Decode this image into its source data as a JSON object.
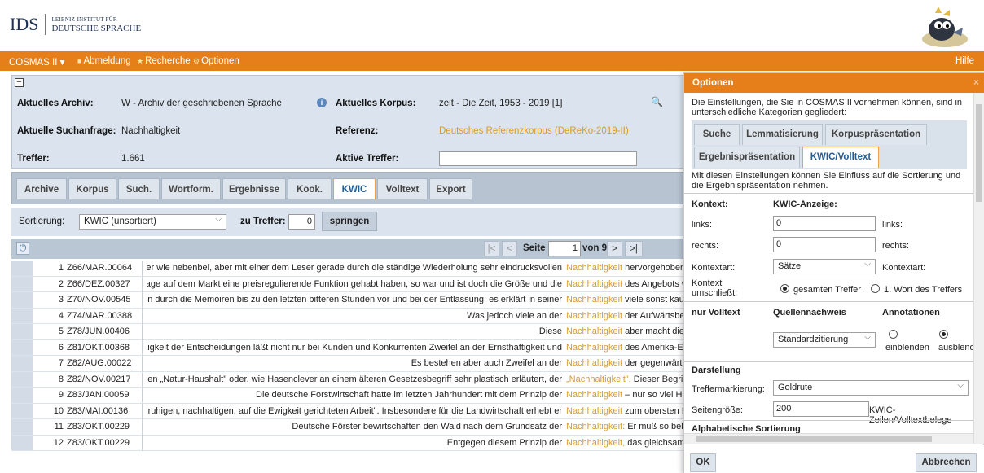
{
  "header": {
    "logo_main": "IDS",
    "logo_line1": "LEIBNIZ-INSTITUT FÜR",
    "logo_line2": "DEUTSCHE SPRACHE"
  },
  "menubar": {
    "app": "COSMAS II ▾",
    "abmeldung": "Abmeldung",
    "recherche": "Recherche",
    "optionen": "Optionen",
    "hilfe": "Hilfe"
  },
  "info": {
    "archiv_label": "Aktuelles Archiv:",
    "archiv_value": "W - Archiv der geschriebenen Sprache",
    "korpus_label": "Aktuelles Korpus:",
    "korpus_value": "zeit - Die Zeit, 1953 - 2019 [1]",
    "suchanfrage_label": "Aktuelle Suchanfrage:",
    "suchanfrage_value": "Nachhaltigkeit",
    "referenz_label": "Referenz:",
    "referenz_value": "Deutsches Referenzkorpus (DeReKo-2019-II)",
    "treffer_label": "Treffer:",
    "treffer_value": "1.661",
    "aktive_label": "Aktive Treffer:",
    "aktive_value": ""
  },
  "tabs": [
    "Archive",
    "Korpus",
    "Such.",
    "Wortform.",
    "Ergebnisse",
    "Kook.",
    "KWIC",
    "Volltext",
    "Export"
  ],
  "active_tab": "KWIC",
  "sortbar": {
    "label": "Sortierung:",
    "selected": "KWIC (unsortiert)",
    "zu_label": "zu Treffer:",
    "zu_value": "0",
    "button": "springen"
  },
  "pager": {
    "first": "|<",
    "prev": "<",
    "label": "Seite",
    "page": "1",
    "of": "von 9",
    "next": ">",
    "last": ">|"
  },
  "rows": [
    {
      "no": "1",
      "sig": "Z66/MAR.00064",
      "left": "...er wie nebenbei, aber mit einer dem Leser gerade durch die ständige Wiederholung sehr eindrucksvollen",
      "kw": "Nachhaltigkeit",
      "right": " hervorgehoben,"
    },
    {
      "no": "2",
      "sig": "Z66/DEZ.00327",
      "left": "...age auf dem Markt eine preisregulierende Funktion gehabt haben, so war und ist doch die Größe und die",
      "kw": "Nachhaltigkeit",
      "right": " des Angebots w"
    },
    {
      "no": "3",
      "sig": "Z70/NOV.00545",
      "left": "...n durch die Memoiren bis zu den letzten bitteren Stunden vor und bei der Entlassung; es erklärt in seiner",
      "kw": "Nachhaltigkeit",
      "right": " viele sonst kaum"
    },
    {
      "no": "4",
      "sig": "Z74/MAR.00388",
      "left": "Was jedoch viele an der",
      "kw": "Nachhaltigkeit",
      "right": " der Aufwärtsbe"
    },
    {
      "no": "5",
      "sig": "Z78/JUN.00406",
      "left": "Diese",
      "kw": "Nachhaltigkeit",
      "right": " aber macht die"
    },
    {
      "no": "6",
      "sig": "Z81/OKT.00368",
      "left": "...tigkeit der Entscheidungen läßt nicht nur bei Kunden und Konkurrenten Zweifel an der Ernsthaftigkeit und",
      "kw": "Nachhaltigkeit",
      "right": " des Amerika-En"
    },
    {
      "no": "7",
      "sig": "Z82/AUG.00022",
      "left": "Es bestehen aber auch Zweifel an der",
      "kw": "Nachhaltigkeit",
      "right": " der gegenwärtig"
    },
    {
      "no": "8",
      "sig": "Z82/NOV.00217",
      "left": "...en „Natur-Haushalt\" oder, wie Hasenclever an einem älteren Gesetzesbegriff sehr plastisch erläutert, der",
      "kw": "„Nachhaltigkeit\".",
      "right": " Dieser Begriff"
    },
    {
      "no": "9",
      "sig": "Z83/JAN.00059",
      "left": "Die deutsche Forstwirtschaft hatte im letzten Jahrhundert mit dem Prinzip der",
      "kw": "Nachhaltigkeit",
      "right": " – nur so viel Ho"
    },
    {
      "no": "10",
      "sig": "Z83/MAI.00136",
      "left": "...r ruhigen, nachhaltigen, auf die Ewigkeit gerichteten Arbeit\". Insbesondere für die Landwirtschaft erhebt er",
      "kw": "Nachhaltigkeit",
      "right": " zum obersten P"
    },
    {
      "no": "11",
      "sig": "Z83/OKT.00229",
      "left": "Deutsche Förster bewirtschaften den Wald nach dem Grundsatz der",
      "kw": "Nachhaltigkeit:",
      "right": " Er muß so beh"
    },
    {
      "no": "12",
      "sig": "Z83/OKT.00229",
      "left": "Entgegen diesem Prinzip der",
      "kw": "Nachhaltigkeit,",
      "right": " das gleichsam"
    }
  ],
  "dialog": {
    "title": "Optionen",
    "close": "×",
    "intro": "Die Einstellungen, die Sie in COSMAS II vornehmen können, sind in unterschiedliche Kategorien gegliedert:",
    "tabs_row1": [
      "Suche",
      "Lemmatisierung",
      "Korpuspräsentation"
    ],
    "tabs_row2": [
      "Ergebnispräsentation",
      "KWIC/Volltext"
    ],
    "active_tab": "KWIC/Volltext",
    "desc": "Mit diesen Einstellungen können Sie Einfluss auf die Sortierung und die Ergebnispräsentation nehmen.",
    "kontext": "Kontext:",
    "kwic_anzeige": "KWIC-Anzeige:",
    "links": "links:",
    "links_value": "0",
    "links2": "links:",
    "rechts": "rechts:",
    "rechts_value": "0",
    "rechts2": "rechts:",
    "kontextart": "Kontextart:",
    "kontextart_value": "Sätze",
    "kontextart2": "Kontextart:",
    "umschliesst": "Kontext umschließt:",
    "opt_gesamt": "gesamten Treffer",
    "opt_erstes": "1. Wort des Treffers",
    "nur_volltext": "nur Volltext",
    "quellennachweis": "Quellennachweis",
    "annotationen": "Annotationen",
    "quellen_value": "Standardzitierung",
    "einblenden": "einblenden",
    "ausblenden": "ausblend",
    "darstellung": "Darstellung",
    "treffermarkierung": "Treffermarkierung:",
    "treffermarkierung_value": "Goldrute",
    "seitengroesse": "Seitengröße:",
    "seitengroesse_value": "200",
    "seitengroesse_unit": "KWIC-Zeilen/Volltextbelege",
    "alpha": "Alphabetische Sortierung",
    "ok": "OK",
    "abbrechen": "Abbrechen"
  },
  "colors": {
    "accent": "#e67f1a",
    "keyword": "#d99b2b",
    "link": "#245d94"
  }
}
